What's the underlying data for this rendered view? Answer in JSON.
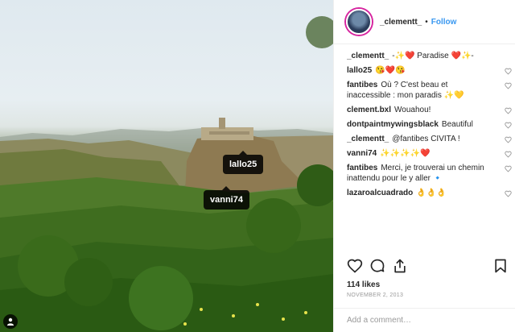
{
  "photo": {
    "tags": [
      "lallo25",
      "vanni74"
    ]
  },
  "post": {
    "username": "_clementt_",
    "separator": "•",
    "follow_label": "Follow",
    "comments": [
      {
        "user": "_clementt_",
        "text": "-✨❤️ Paradise ❤️✨-"
      },
      {
        "user": "lallo25",
        "text": "😘❤️😘"
      },
      {
        "user": "fantibes",
        "text": "Où ? C'est beau et\ninaccessible : mon paradis ✨💛"
      },
      {
        "user": "clement.bxl",
        "text": "Wouahou!"
      },
      {
        "user": "dontpaintmywingsblack",
        "text": "Beautiful"
      },
      {
        "user": "_clementt_",
        "text": "@fantibes CIVITA !"
      },
      {
        "user": "vanni74",
        "text": "✨✨✨✨❤️"
      },
      {
        "user": "fantibes",
        "text": "Merci, je trouverai un chemin\ninattendu pour le y aller 🔹"
      },
      {
        "user": "lazaroalcuadrado",
        "text": "👌👌👌"
      }
    ],
    "likes": "114 likes",
    "date": "NOVEMBER 2, 2013",
    "add_comment_placeholder": "Add a comment…"
  }
}
